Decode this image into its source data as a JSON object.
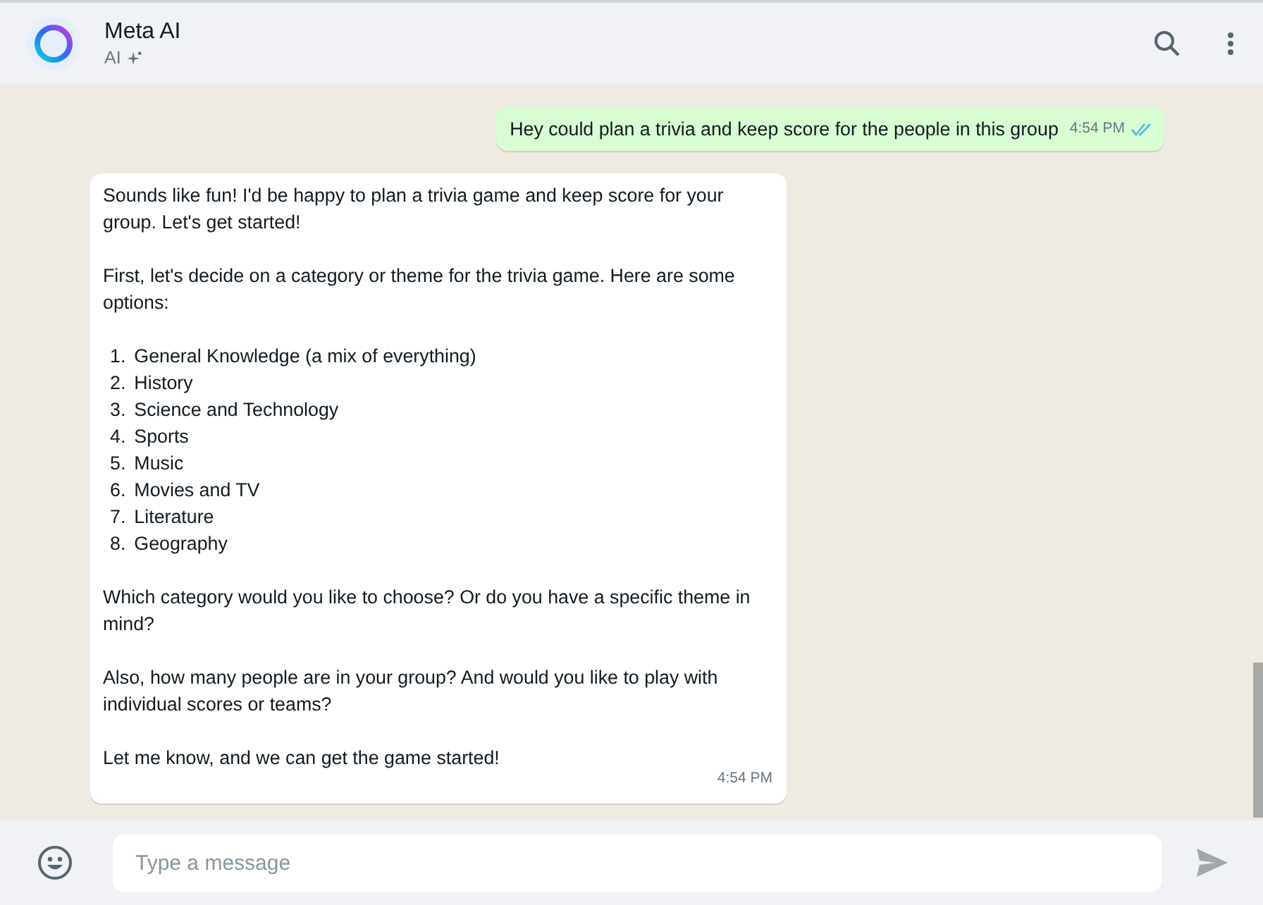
{
  "header": {
    "title": "Meta AI",
    "subtitle": "AI"
  },
  "messages": [
    {
      "kind": "outgoing",
      "text": "Hey could plan a trivia and keep score for the people in this group",
      "time": "4:54 PM",
      "read": true
    },
    {
      "kind": "incoming",
      "time": "4:54 PM",
      "blocks": [
        {
          "kind": "paragraph",
          "text": "Sounds like fun! I'd be happy to plan a trivia game and keep score for your group. Let's get started!"
        },
        {
          "kind": "paragraph",
          "text": "First, let's decide on a category or theme for the trivia game. Here are some options:"
        },
        {
          "kind": "list",
          "items": [
            {
              "number": "1.",
              "text": "General Knowledge (a mix of everything)"
            },
            {
              "number": "2.",
              "text": "History"
            },
            {
              "number": "3.",
              "text": "Science and Technology"
            },
            {
              "number": "4.",
              "text": "Sports"
            },
            {
              "number": "5.",
              "text": "Music"
            },
            {
              "number": "6.",
              "text": "Movies and TV"
            },
            {
              "number": "7.",
              "text": "Literature"
            },
            {
              "number": "8.",
              "text": "Geography"
            }
          ]
        },
        {
          "kind": "paragraph",
          "text": "Which category would you like to choose? Or do you have a specific theme in mind?"
        },
        {
          "kind": "paragraph",
          "text": "Also, how many people are in your group? And would you like to play with individual scores or teams?"
        },
        {
          "kind": "paragraph",
          "text": "Let me know, and we can get the game started!"
        }
      ]
    }
  ],
  "composer": {
    "placeholder": "Type a message"
  }
}
